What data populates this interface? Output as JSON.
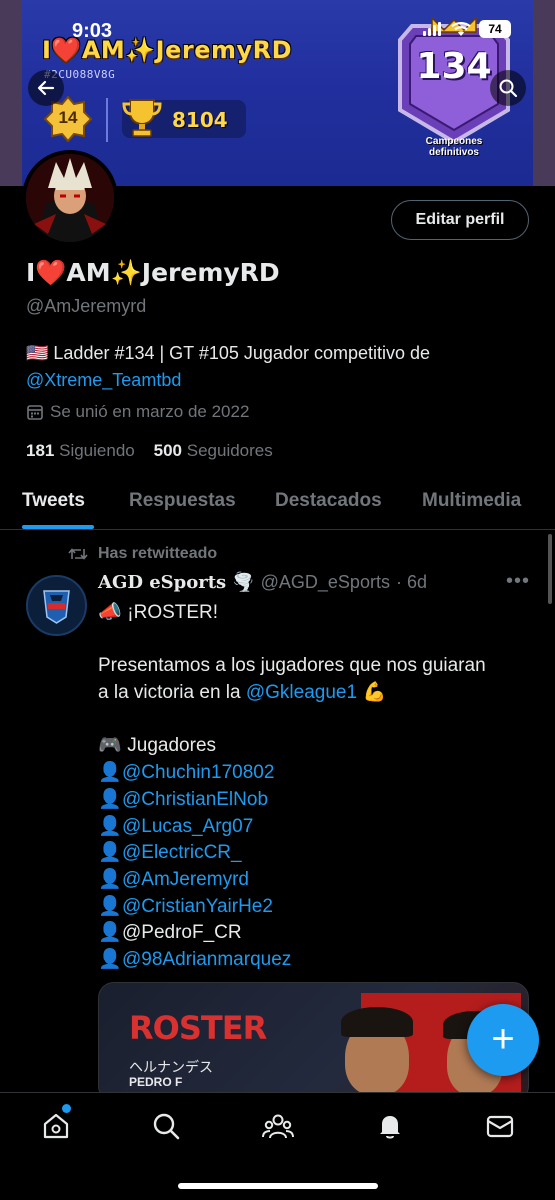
{
  "status_bar": {
    "time": "9:03",
    "battery": "74"
  },
  "banner": {
    "title": "I❤️AM✨JeremyRD",
    "tag": "#2CU088V8G",
    "level": "14",
    "trophies": "8104",
    "champion_number": "134",
    "champion_label_line1": "Campeones",
    "champion_label_line2": "definitivos"
  },
  "profile": {
    "edit_button": "Editar perfil",
    "display_name": "I❤️AM✨JeremyRD",
    "handle": "@AmJeremyrd",
    "bio_text": "🇺🇸 Ladder #134 | GT #105 Jugador competitivo de",
    "bio_link": "@Xtreme_Teamtbd",
    "joined": "Se unió en marzo de 2022",
    "following_count": "181",
    "following_label": "Siguiendo",
    "followers_count": "500",
    "followers_label": "Seguidores"
  },
  "tabs": [
    "Tweets",
    "Respuestas",
    "Destacados",
    "Multimedia"
  ],
  "tweet": {
    "retweet_label": "Has retwitteado",
    "author_name": "AGD eSports",
    "author_emoji": "🌪️",
    "author_handle": "@AGD_eSports",
    "time": "· 6d",
    "lines": {
      "l1": "¡ROSTER!",
      "l2": "Presentamos a los jugadores que nos guiaran",
      "l3": "a la victoria en la",
      "l3_link": "@Gkleague1",
      "l4": "Jugadores",
      "players": [
        "@Chuchin170802",
        "@ChristianElNob",
        "@Lucas_Arg07",
        "@ElectricCR_",
        "@AmJeremyrd",
        "@CristianYairHe2",
        "@PedroF_CR",
        "@98Adrianmarquez"
      ]
    },
    "media": {
      "title": "ROSTER",
      "japanese": "ヘルナンデス",
      "name": "PEDRO F"
    }
  },
  "fab_label": "+",
  "nav": [
    "home",
    "search",
    "communities",
    "notifications",
    "messages"
  ]
}
